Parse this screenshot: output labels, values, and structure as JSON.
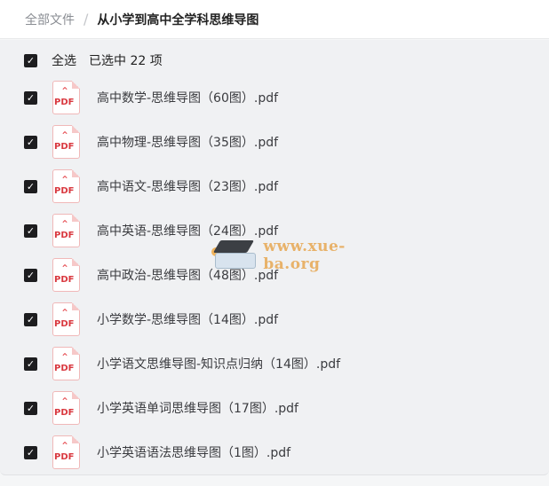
{
  "breadcrumb": {
    "root": "全部文件",
    "separator": "/",
    "current": "从小学到高中全学科思维导图"
  },
  "selection": {
    "select_all_label": "全选",
    "selected_count_text": "已选中  22  项",
    "checkbox_mark": "✓"
  },
  "files": [
    {
      "name": "高中数学-思维导图（60图）.pdf",
      "icon_label": "PDF",
      "checked": true
    },
    {
      "name": "高中物理-思维导图（35图）.pdf",
      "icon_label": "PDF",
      "checked": true
    },
    {
      "name": "高中语文-思维导图（23图）.pdf",
      "icon_label": "PDF",
      "checked": true
    },
    {
      "name": "高中英语-思维导图（24图）.pdf",
      "icon_label": "PDF",
      "checked": true
    },
    {
      "name": "高中政治-思维导图（48图）.pdf",
      "icon_label": "PDF",
      "checked": true
    },
    {
      "name": "小学数学-思维导图（14图）.pdf",
      "icon_label": "PDF",
      "checked": true
    },
    {
      "name": "小学语文思维导图-知识点归纳（14图）.pdf",
      "icon_label": "PDF",
      "checked": true
    },
    {
      "name": "小学英语单词思维导图（17图）.pdf",
      "icon_label": "PDF",
      "checked": true
    },
    {
      "name": "小学英语语法思维导图（1图）.pdf",
      "icon_label": "PDF",
      "checked": true
    }
  ],
  "watermark": {
    "text": "www.xue-ba.org"
  },
  "colors": {
    "checkbox": "#1d1d1f",
    "pdf_red": "#e5484d",
    "watermark": "#e8b26a"
  },
  "icons": {
    "checkbox": "checkmark-icon",
    "file": "pdf-file-icon",
    "watermark": "graduation-cap-icon"
  }
}
